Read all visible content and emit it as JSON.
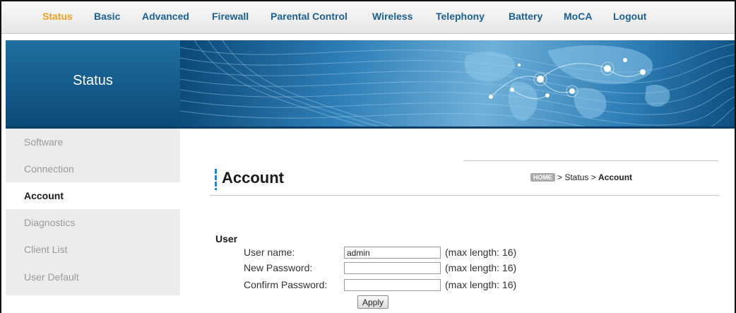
{
  "nav": {
    "items": [
      {
        "label": "Status",
        "active": true
      },
      {
        "label": "Basic",
        "active": false
      },
      {
        "label": "Advanced",
        "active": false
      },
      {
        "label": "Firewall",
        "active": false
      },
      {
        "label": "Parental Control",
        "active": false
      },
      {
        "label": "Wireless",
        "active": false
      },
      {
        "label": "Telephony",
        "active": false
      },
      {
        "label": "Battery",
        "active": false
      },
      {
        "label": "MoCA",
        "active": false
      },
      {
        "label": "Logout",
        "active": false
      }
    ]
  },
  "banner": {
    "title": "Status"
  },
  "sidebar": {
    "items": [
      {
        "label": "Software",
        "active": false
      },
      {
        "label": "Connection",
        "active": false
      },
      {
        "label": "Account",
        "active": true
      },
      {
        "label": "Diagnostics",
        "active": false
      },
      {
        "label": "Client List",
        "active": false
      },
      {
        "label": "User Default",
        "active": false
      }
    ]
  },
  "page": {
    "title": "Account",
    "breadcrumb": {
      "home": "HOME",
      "sep1": "> Status >",
      "current": "Account"
    }
  },
  "form": {
    "section": "User",
    "username": {
      "label": "User name:",
      "value": "admin",
      "hint": "(max length: 16)"
    },
    "new_password": {
      "label": "New Password:",
      "value": "",
      "hint": "(max length: 16)"
    },
    "confirm_password": {
      "label": "Confirm Password:",
      "value": "",
      "hint": "(max length: 16)"
    },
    "apply_label": "Apply"
  },
  "colors": {
    "nav_text": "#1c5f95",
    "nav_active": "#f0a020",
    "banner": "#0c4a76",
    "title_bar_accent": "#1e88d0"
  }
}
